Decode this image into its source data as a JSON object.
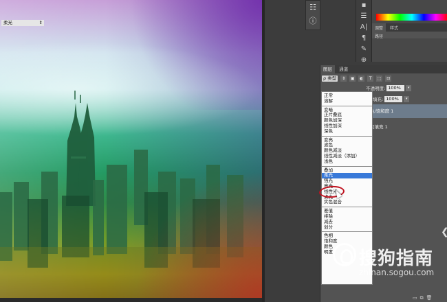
{
  "colors": {
    "panel_bg": "#535353",
    "dropdown_bg": "#fbfbfb",
    "selection": "#3879d9",
    "highlight_circle": "#c1121f",
    "selected_layer": "#6d7c8c"
  },
  "tool_strip": {
    "tools": [
      {
        "icon": "adjustments-icon",
        "glyph": "☷"
      },
      {
        "icon": "info-icon",
        "glyph": "ⓘ"
      }
    ]
  },
  "tool_column": {
    "tools": [
      {
        "icon": "color-swatch-icon",
        "glyph": "▪"
      },
      {
        "icon": "sliders-icon",
        "glyph": "☰"
      },
      {
        "icon": "character-icon",
        "glyph": "A|"
      },
      {
        "icon": "paragraph-icon",
        "glyph": "¶"
      },
      {
        "icon": "brush-icon",
        "glyph": "✎"
      },
      {
        "icon": "clone-icon",
        "glyph": "⊕"
      }
    ]
  },
  "color_panel": {
    "tabs": [
      "调整",
      "样式"
    ],
    "row_label": "路径"
  },
  "layers_panel": {
    "tabs": [
      "图层",
      "通道"
    ],
    "filter_label": "ρ 类型",
    "blend_mode": "柔光",
    "opacity_label": "不透明度:",
    "opacity_value": "100%",
    "fill_label": "填充:",
    "fill_value": "100%",
    "layers": [
      {
        "name": "色/饱和度 1",
        "selected": true
      },
      {
        "name": "变填充 1",
        "selected": false
      }
    ]
  },
  "blend_modes": [
    [
      "正常",
      "溶解"
    ],
    [
      "变暗",
      "正片叠底",
      "颜色加深",
      "线性加深",
      "深色"
    ],
    [
      "变亮",
      "滤色",
      "颜色减淡",
      "线性减淡（添加）",
      "浅色"
    ],
    [
      "叠加",
      "柔光",
      "强光",
      "亮光",
      "线性光",
      "点光",
      "实色混合"
    ],
    [
      "差值",
      "排除",
      "减去",
      "划分"
    ],
    [
      "色相",
      "饱和度",
      "颜色",
      "明度"
    ]
  ],
  "selected_blend_mode": "柔光",
  "watermark": {
    "brand": "搜狗指南",
    "url": "zhinan.sogou.com"
  }
}
